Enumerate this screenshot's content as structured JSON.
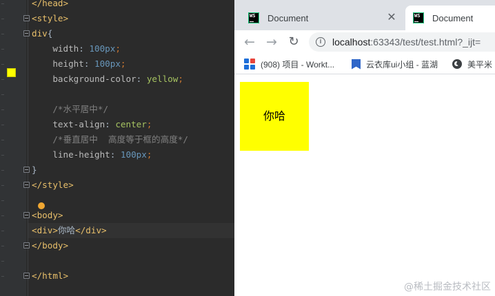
{
  "editor": {
    "lines": [
      {
        "parts": [
          {
            "t": "</head>",
            "c": "tag"
          }
        ]
      },
      {
        "parts": [
          {
            "t": "<style>",
            "c": "tag"
          }
        ]
      },
      {
        "parts": [
          {
            "t": "div",
            "c": "sel"
          },
          {
            "t": "{",
            "c": "punc"
          }
        ]
      },
      {
        "parts": [
          {
            "t": "    width",
            "c": "prop"
          },
          {
            "t": ": ",
            "c": "punc"
          },
          {
            "t": "100",
            "c": "num"
          },
          {
            "t": "px",
            "c": "unit"
          },
          {
            "t": ";",
            "c": "kw"
          }
        ]
      },
      {
        "parts": [
          {
            "t": "    height",
            "c": "prop"
          },
          {
            "t": ": ",
            "c": "punc"
          },
          {
            "t": "100",
            "c": "num"
          },
          {
            "t": "px",
            "c": "unit"
          },
          {
            "t": ";",
            "c": "kw"
          }
        ]
      },
      {
        "parts": [
          {
            "t": "    background-color",
            "c": "prop"
          },
          {
            "t": ": ",
            "c": "punc"
          },
          {
            "t": "yellow",
            "c": "val"
          },
          {
            "t": ";",
            "c": "kw"
          }
        ]
      },
      {
        "parts": []
      },
      {
        "parts": [
          {
            "t": "    /*水平居中*/",
            "c": "cmt"
          }
        ]
      },
      {
        "parts": [
          {
            "t": "    text-align",
            "c": "prop"
          },
          {
            "t": ": ",
            "c": "punc"
          },
          {
            "t": "center",
            "c": "val"
          },
          {
            "t": ";",
            "c": "kw"
          }
        ]
      },
      {
        "parts": [
          {
            "t": "    /*垂直居中  高度等于框的高度*/",
            "c": "cmt"
          }
        ]
      },
      {
        "parts": [
          {
            "t": "    line-height",
            "c": "prop"
          },
          {
            "t": ": ",
            "c": "punc"
          },
          {
            "t": "100",
            "c": "num"
          },
          {
            "t": "px",
            "c": "unit"
          },
          {
            "t": ";",
            "c": "kw"
          }
        ]
      },
      {
        "parts": [
          {
            "t": "}",
            "c": "punc"
          }
        ]
      },
      {
        "parts": [
          {
            "t": "</style>",
            "c": "tag"
          }
        ]
      },
      {
        "parts": []
      },
      {
        "parts": [
          {
            "t": "<body>",
            "c": "tag"
          }
        ]
      },
      {
        "parts": [
          {
            "t": "<div>",
            "c": "tag"
          },
          {
            "t": "你哈",
            "c": "text"
          },
          {
            "t": "</div>",
            "c": "tag"
          }
        ],
        "current": true
      },
      {
        "parts": [
          {
            "t": "</body>",
            "c": "tag"
          }
        ]
      },
      {
        "parts": []
      },
      {
        "parts": [
          {
            "t": "</html>",
            "c": "tag"
          }
        ]
      }
    ],
    "swatch_color": "#ffff00"
  },
  "browser": {
    "tabs": [
      {
        "title": "Document",
        "active": false,
        "icon": "webstorm-icon"
      },
      {
        "title": "Document",
        "active": true,
        "icon": "webstorm-icon"
      }
    ],
    "url_host": "localhost",
    "url_rest": ":63343/test/test.html?_ijt=",
    "bookmarks": [
      {
        "label": "(908) 项目 - Workt...",
        "icon": "worktile-icon"
      },
      {
        "label": "云衣库ui小组 - 蓝湖",
        "icon": "lanhu-icon"
      },
      {
        "label": "美平米",
        "icon": "globe-icon"
      }
    ],
    "page": {
      "box_text": "你哈",
      "box_color": "#ffff00"
    }
  },
  "watermark": "@稀土掘金技术社区"
}
